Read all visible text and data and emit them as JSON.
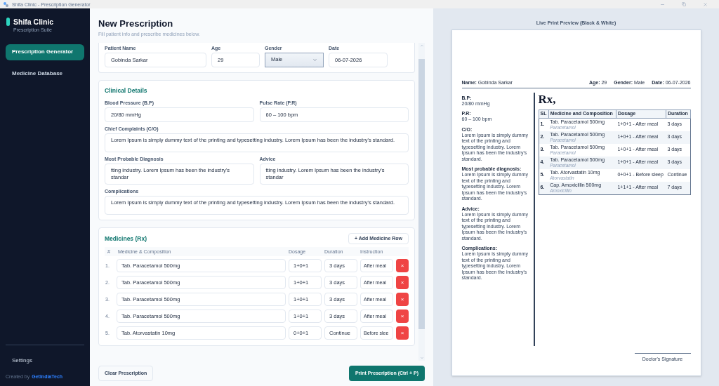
{
  "window": {
    "title": "Shifa Clinic - Prescription Generator"
  },
  "sidebar": {
    "brand": "Shifa Clinic",
    "subtitle": "Prescription Suite",
    "items": [
      {
        "label": "Prescription Generator",
        "selected": true
      },
      {
        "label": "Medicine Database",
        "selected": false
      }
    ],
    "settings": "Settings",
    "credit": {
      "prefix": "Created by",
      "link": "GetIndiaTech"
    }
  },
  "header": {
    "title": "New Prescription",
    "subtitle": "Fill patient info and prescribe medicines below."
  },
  "patient": {
    "fields": [
      {
        "label": "Patient Name",
        "value": "Gobinda Sarkar",
        "kind": "input"
      },
      {
        "label": "Age",
        "value": "29",
        "kind": "input"
      },
      {
        "label": "Gender",
        "value": "Male",
        "kind": "select"
      },
      {
        "label": "Date",
        "value": "06-07-2026",
        "kind": "input"
      }
    ]
  },
  "clinical": {
    "title": "Clinical Details",
    "rows": [
      [
        {
          "label": "Blood Pressure (B.P)",
          "value": "20/80 mmHg",
          "kind": "input"
        },
        {
          "label": "Pulse Rate (P.R)",
          "value": "60 – 100 bpm",
          "kind": "input"
        }
      ],
      [
        {
          "label": "Chief Complaints (C/O)",
          "value": "Lorem Ipsum is simply dummy text of the printing and typesetting industry. Lorem Ipsum has been the industry's standard.",
          "kind": "textarea"
        }
      ],
      [
        {
          "label": "Most Probable Diagnosis",
          "value": "tting industry. Lorem Ipsum has been the industry's standar",
          "kind": "textarea"
        },
        {
          "label": "Advice",
          "value": "tting industry. Lorem Ipsum has been the industry's standar",
          "kind": "textarea"
        }
      ],
      [
        {
          "label": "Complications",
          "value": "Lorem Ipsum is simply dummy text of the printing and typesetting industry. Lorem Ipsum has been the industry's standard.",
          "kind": "textarea"
        }
      ]
    ]
  },
  "medicines": {
    "title": "Medicines (Rx)",
    "add_button": "+ Add Medicine Row",
    "columns": [
      "#",
      "Medicine & Composition",
      "Dosage",
      "Duration",
      "Instruction"
    ],
    "rows": [
      {
        "index": "1.",
        "medicine": "Tab. Paracetamol 500mg",
        "dosage": "1+0+1",
        "duration": "3 days",
        "instruction": "After meal",
        "remove": "×",
        "focused": false
      },
      {
        "index": "2.",
        "medicine": "Tab. Paracetamol 500mg",
        "dosage": "1+0+1",
        "duration": "3 days",
        "instruction": "After meal",
        "remove": "×",
        "focused": false
      },
      {
        "index": "3.",
        "medicine": "Tab. Paracetamol 500mg",
        "dosage": "1+0+1",
        "duration": "3 days",
        "instruction": "After meal",
        "remove": "×",
        "focused": false
      },
      {
        "index": "4.",
        "medicine": "Tab. Paracetamol 500mg",
        "dosage": "1+0+1",
        "duration": "3 days",
        "instruction": "After meal",
        "remove": "×",
        "focused": false
      },
      {
        "index": "5.",
        "medicine": "Tab. Atorvastatin 10mg",
        "dosage": "0+0+1",
        "duration": "Continue",
        "instruction": "Before slee",
        "remove": "×",
        "focused": false
      }
    ]
  },
  "actions": {
    "clear": "Clear Prescription",
    "print": "Print Prescription (Ctrl + P)"
  },
  "preview": {
    "caption": "Live Print Preview (Black & White)",
    "header": [
      {
        "label": "Name:",
        "value": "Gobinda Sarkar"
      },
      {
        "label": "Age:",
        "value": "29"
      },
      {
        "label": "Gender:",
        "value": "Male"
      },
      {
        "label": "Date:",
        "value": "06-07-2026"
      }
    ],
    "notes": [
      {
        "label": "B.P:",
        "text": "20/80 mmHg"
      },
      {
        "label": "P.R:",
        "text": "60 – 100 bpm"
      },
      {
        "label": "C/O:",
        "text": "Lorem Ipsum is simply dummy text of the printing and typesetting industry. Lorem Ipsum has been the industry's standard."
      },
      {
        "label": "Most probable diagnosis:",
        "text": "Lorem Ipsum is simply dummy text of the printing and typesetting industry. Lorem Ipsum has been the industry's standard."
      },
      {
        "label": "Advice:",
        "text": "Lorem Ipsum is simply dummy text of the printing and typesetting industry. Lorem Ipsum has been the industry's standard."
      },
      {
        "label": "Complications:",
        "text": "Lorem Ipsum is simply dummy text of the printing and typesetting industry. Lorem Ipsum has been the industry's standard."
      }
    ],
    "rx": "Rx,",
    "table": {
      "columns": [
        "SL",
        "Medicine and Composition",
        "Dosage",
        "Duration"
      ],
      "rows": [
        {
          "sl": "1.",
          "medicine": "Tab. Paracetamol 500mg",
          "generic": "Paracetamol",
          "dosage": "1+0+1 - After meal",
          "duration": "3 days"
        },
        {
          "sl": "2.",
          "medicine": "Tab. Paracetamol 500mg",
          "generic": "Paracetamol",
          "dosage": "1+0+1 - After meal",
          "duration": "3 days"
        },
        {
          "sl": "3.",
          "medicine": "Tab. Paracetamol 500mg",
          "generic": "Paracetamol",
          "dosage": "1+0+1 - After meal",
          "duration": "3 days"
        },
        {
          "sl": "4.",
          "medicine": "Tab. Paracetamol 500mg",
          "generic": "Paracetamol",
          "dosage": "1+0+1 - After meal",
          "duration": "3 days"
        },
        {
          "sl": "5.",
          "medicine": "Tab. Atorvastatin 10mg",
          "generic": "Atorvastatin",
          "dosage": "0+0+1 - Before sleep",
          "duration": "Continue"
        },
        {
          "sl": "6.",
          "medicine": "Cap. Amoxicillin 500mg",
          "generic": "Amoxicillin",
          "dosage": "1+1+1 - After meal",
          "duration": "7 days"
        }
      ]
    },
    "signature": "Doctor's Signature"
  }
}
